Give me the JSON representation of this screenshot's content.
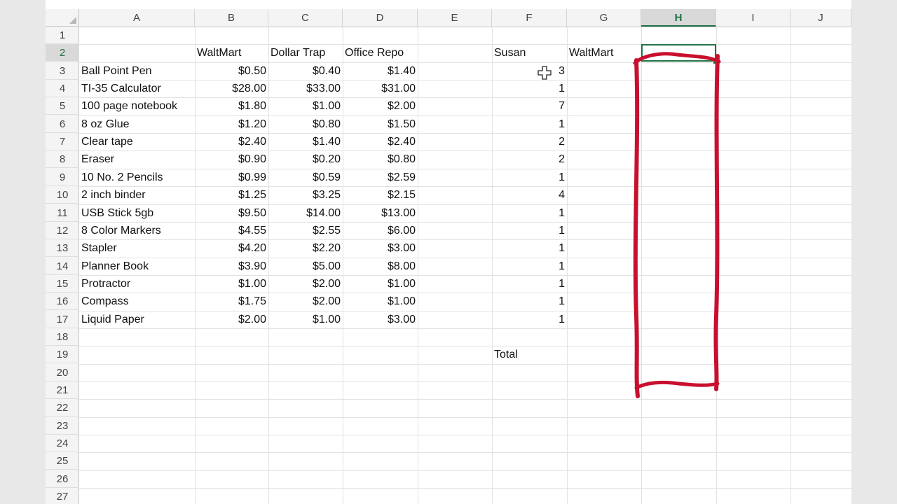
{
  "columns": [
    "A",
    "B",
    "C",
    "D",
    "E",
    "F",
    "G",
    "H",
    "I",
    "J"
  ],
  "active_column": "H",
  "rows": [
    "1",
    "2",
    "3",
    "4",
    "5",
    "6",
    "7",
    "8",
    "9",
    "10",
    "11",
    "12",
    "13",
    "14",
    "15",
    "16",
    "17",
    "18",
    "19",
    "20",
    "21",
    "22",
    "23",
    "24",
    "25",
    "26",
    "27"
  ],
  "header_row": {
    "walmart": "WaltMart",
    "dollar_trap": "Dollar Trap",
    "office_repo": "Office Repo",
    "susan": "Susan",
    "walmart_g": "WaltMart"
  },
  "items": [
    {
      "name": "Ball Point Pen",
      "walmart": "$0.50",
      "dollar_trap": "$0.40",
      "office_repo": "$1.40",
      "qty": "3"
    },
    {
      "name": "TI-35 Calculator",
      "walmart": "$28.00",
      "dollar_trap": "$33.00",
      "office_repo": "$31.00",
      "qty": "1"
    },
    {
      "name": "100 page notebook",
      "walmart": "$1.80",
      "dollar_trap": "$1.00",
      "office_repo": "$2.00",
      "qty": "7"
    },
    {
      "name": "8 oz Glue",
      "walmart": "$1.20",
      "dollar_trap": "$0.80",
      "office_repo": "$1.50",
      "qty": "1"
    },
    {
      "name": "Clear tape",
      "walmart": "$2.40",
      "dollar_trap": "$1.40",
      "office_repo": "$2.40",
      "qty": "2"
    },
    {
      "name": "Eraser",
      "walmart": "$0.90",
      "dollar_trap": "$0.20",
      "office_repo": "$0.80",
      "qty": "2"
    },
    {
      "name": "10 No. 2 Pencils",
      "walmart": "$0.99",
      "dollar_trap": "$0.59",
      "office_repo": "$2.59",
      "qty": "1"
    },
    {
      "name": "2 inch binder",
      "walmart": "$1.25",
      "dollar_trap": "$3.25",
      "office_repo": "$2.15",
      "qty": "4"
    },
    {
      "name": "USB Stick 5gb",
      "walmart": "$9.50",
      "dollar_trap": "$14.00",
      "office_repo": "$13.00",
      "qty": "1"
    },
    {
      "name": "8 Color Markers",
      "walmart": "$4.55",
      "dollar_trap": "$2.55",
      "office_repo": "$6.00",
      "qty": "1"
    },
    {
      "name": "Stapler",
      "walmart": "$4.20",
      "dollar_trap": "$2.20",
      "office_repo": "$3.00",
      "qty": "1"
    },
    {
      "name": "Planner Book",
      "walmart": "$3.90",
      "dollar_trap": "$5.00",
      "office_repo": "$8.00",
      "qty": "1"
    },
    {
      "name": "Protractor",
      "walmart": "$1.00",
      "dollar_trap": "$2.00",
      "office_repo": "$1.00",
      "qty": "1"
    },
    {
      "name": "Compass",
      "walmart": "$1.75",
      "dollar_trap": "$2.00",
      "office_repo": "$1.00",
      "qty": "1"
    },
    {
      "name": "Liquid Paper",
      "walmart": "$2.00",
      "dollar_trap": "$1.00",
      "office_repo": "$3.00",
      "qty": "1"
    }
  ],
  "total_label": "Total",
  "colors": {
    "accent": "#217346",
    "annotation": "#c8102e",
    "header_bg": "#f4f4f4"
  },
  "icons": {
    "cursor": "cell-select-cross-icon"
  }
}
